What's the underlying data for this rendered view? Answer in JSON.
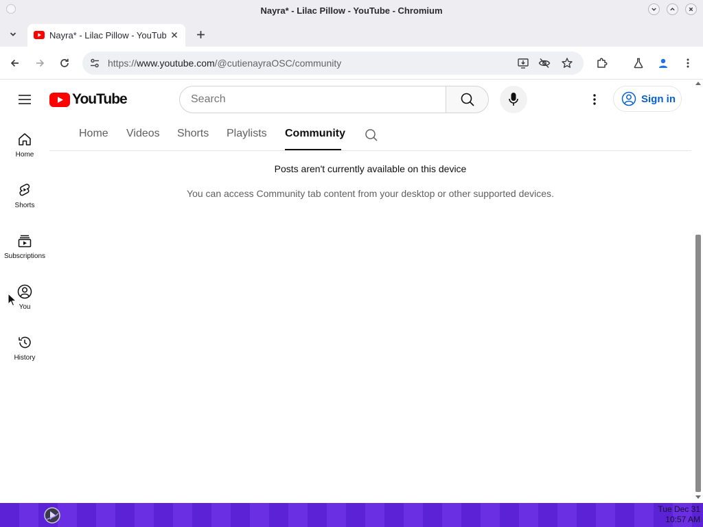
{
  "window": {
    "title": "Nayra* - Lilac Pillow - YouTube - Chromium"
  },
  "browser": {
    "tab": {
      "title": "Nayra* - Lilac Pillow - YouTube"
    },
    "url": {
      "scheme": "https://",
      "host": "www.youtube.com",
      "path": "/@cutienayraOSC/community"
    }
  },
  "youtube": {
    "logo_text": "YouTube",
    "search_placeholder": "Search",
    "sign_in_label": "Sign in",
    "brand_color": "#ff0000",
    "link_color": "#065fd4"
  },
  "guide": {
    "items": [
      {
        "label": "Home",
        "icon": "home-icon"
      },
      {
        "label": "Shorts",
        "icon": "shorts-icon"
      },
      {
        "label": "Subscriptions",
        "icon": "subscriptions-icon"
      },
      {
        "label": "You",
        "icon": "account-icon"
      },
      {
        "label": "History",
        "icon": "history-icon"
      }
    ]
  },
  "channel_tabs": {
    "items": [
      {
        "label": "Home"
      },
      {
        "label": "Videos"
      },
      {
        "label": "Shorts"
      },
      {
        "label": "Playlists"
      },
      {
        "label": "Community",
        "active": true
      }
    ]
  },
  "message": {
    "title": "Posts aren't currently available on this device",
    "body": "You can access Community tab content from your desktop or other supported devices."
  },
  "taskbar": {
    "clock_line1": "Tue Dec 31",
    "clock_line2": "10:57 AM",
    "color": "#5b22d6"
  }
}
